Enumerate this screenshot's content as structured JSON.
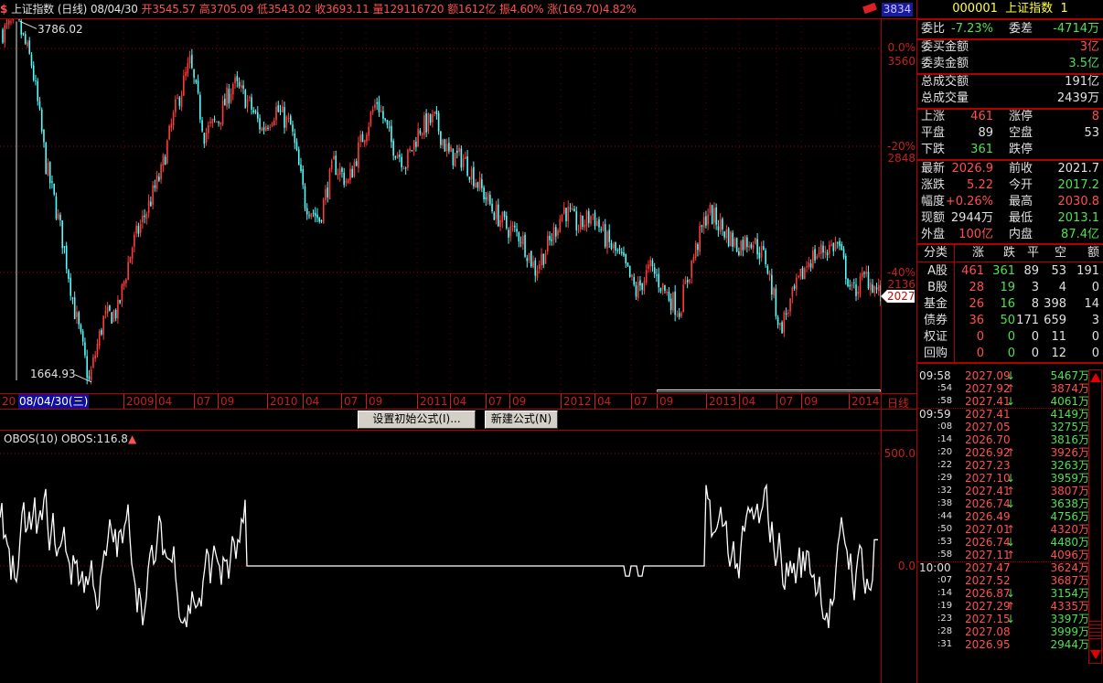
{
  "title": {
    "icon": "stock-icon",
    "name": "上证指数",
    "period": "(日线)",
    "date": "08/04/30",
    "open": "开3545.57",
    "high": "高3705.09",
    "low": "低3543.02",
    "close": "收3693.11",
    "volume": "量129116720",
    "amount": "额1612亿",
    "amplitude": "振4.60%",
    "change": "涨(169.70)4.82%"
  },
  "top_badge": "3834",
  "price_axis": {
    "pct0": "0.0%",
    "p0": "3560",
    "pct20": "-20%",
    "p20": "2848",
    "pct40": "-40%",
    "p40": "2136",
    "current": "2027"
  },
  "annotations": {
    "high": "3786.02",
    "low": "1664.93"
  },
  "xaxis": {
    "prefix": "20",
    "cursor": "08/04/30(三)",
    "labels": [
      "2009",
      "04",
      "07",
      "09",
      "2010",
      "04",
      "07",
      "09",
      "2011",
      "04",
      "07",
      "09",
      "2012",
      "04",
      "07",
      "09",
      "2013",
      "04",
      "07",
      "09",
      "2014"
    ],
    "period": "日线"
  },
  "buttons": {
    "init_formula": "设置初始公式(I)...",
    "new_formula": "新建公式(N)"
  },
  "obos": {
    "label": "OBOS(10)",
    "value": "OBOS:116.8",
    "axis_top": "500.0",
    "axis_zero": "0.0"
  },
  "chart_data": {
    "type": "candlestick",
    "scale": "log",
    "monthly_closes": [
      3700,
      3786,
      3440,
      2732,
      2361,
      1958,
      1665,
      1920,
      1960,
      2270,
      2460,
      2680,
      3100,
      3440,
      2930,
      3030,
      3290,
      3160,
      2960,
      3100,
      2980,
      2510,
      2410,
      2740,
      2620,
      2909,
      3161,
      2870,
      2740,
      2970,
      3030,
      2792,
      2770,
      2620,
      2470,
      2370,
      2320,
      2150,
      2290,
      2470,
      2370,
      2440,
      2290,
      2200,
      2041,
      2160,
      2050,
      1960,
      2218,
      2460,
      2360,
      2270,
      2310,
      2200,
      1877,
      2040,
      2200,
      2250,
      2280,
      2040,
      2120,
      2027
    ],
    "high": 3786.02,
    "low": 1664.93,
    "up_color": "#ff3c3c",
    "down_color": "#54fcfc",
    "obos_ylim": [
      -350,
      550
    ],
    "obos_last": 116.8
  },
  "panel": {
    "header": {
      "code": "000001",
      "name": "上证指数",
      "num": "1"
    },
    "weibi": {
      "l1": "委比",
      "v1": "-7.23%",
      "l2": "委差",
      "v2": "-4714万"
    },
    "buy_amt": {
      "l": "委买金额",
      "v": "3亿"
    },
    "sell_amt": {
      "l": "委卖金额",
      "v": "3.5亿"
    },
    "total_amt": {
      "l": "总成交额",
      "v": "191亿"
    },
    "total_vol": {
      "l": "总成交量",
      "v": "2439万"
    },
    "rise": {
      "l1": "上涨",
      "v1": "461",
      "l2": "涨停",
      "v2": "8"
    },
    "flat": {
      "l1": "平盘",
      "v1": "89",
      "l2": "空盘",
      "v2": "53"
    },
    "fall": {
      "l1": "下跌",
      "v1": "361",
      "l2": "跌停",
      "v2": ""
    },
    "latest": {
      "l1": "最新",
      "v1": "2026.9",
      "l2": "前收",
      "v2": "2021.7"
    },
    "chg": {
      "l1": "涨跌",
      "v1": "5.22",
      "l2": "今开",
      "v2": "2017.2"
    },
    "range": {
      "l1": "幅度",
      "v1": "+0.26%",
      "l2": "最高",
      "v2": "2030.8"
    },
    "cur": {
      "l1": "现额",
      "v1": "2944万",
      "l2": "最低",
      "v2": "2013.1"
    },
    "outer": {
      "l1": "外盘",
      "v1": "100亿",
      "l2": "内盘",
      "v2": "87.4亿"
    },
    "cat_head": [
      "分类",
      "涨",
      "跌",
      "平",
      "空",
      "额"
    ],
    "cats": [
      [
        "A股",
        "461",
        "361",
        "89",
        "53",
        "191"
      ],
      [
        "B股",
        "28",
        "19",
        "3",
        "4",
        "0"
      ],
      [
        "基金",
        "26",
        "16",
        "8",
        "398",
        "14"
      ],
      [
        "债券",
        "36",
        "50",
        "171",
        "659",
        "3"
      ],
      [
        "权证",
        "0",
        "0",
        "0",
        "11",
        "0"
      ],
      [
        "回购",
        "0",
        "0",
        "0",
        "12",
        "0"
      ]
    ],
    "ticks": [
      [
        "09:58",
        "2027.09",
        "down",
        "5467万",
        "g"
      ],
      [
        ":54",
        "2027.92",
        "up",
        "3874万",
        "r"
      ],
      [
        ":58",
        "2027.41",
        "down",
        "4061万",
        "g"
      ],
      [
        "09:59",
        "2027.41",
        "",
        "4149万",
        "g"
      ],
      [
        ":08",
        "2027.05",
        "",
        "3275万",
        "g"
      ],
      [
        ":14",
        "2026.70",
        "",
        "3816万",
        "g"
      ],
      [
        ":20",
        "2026.92",
        "up",
        "3926万",
        "r"
      ],
      [
        ":22",
        "2027.23",
        "",
        "3263万",
        "g"
      ],
      [
        ":29",
        "2027.10",
        "down",
        "3959万",
        "g"
      ],
      [
        ":32",
        "2027.41",
        "up",
        "3807万",
        "r"
      ],
      [
        ":38",
        "2026.74",
        "down",
        "3638万",
        "g"
      ],
      [
        ":44",
        "2026.49",
        "",
        "4756万",
        "g"
      ],
      [
        ":50",
        "2027.01",
        "up",
        "4320万",
        "r"
      ],
      [
        ":53",
        "2026.74",
        "down",
        "4480万",
        "g"
      ],
      [
        ":58",
        "2027.11",
        "up",
        "4096万",
        "r"
      ],
      [
        "10:00",
        "2027.47",
        "",
        "3624万",
        "r"
      ],
      [
        ":07",
        "2027.52",
        "",
        "3687万",
        "r"
      ],
      [
        ":14",
        "2026.87",
        "down",
        "3154万",
        "g"
      ],
      [
        ":19",
        "2027.29",
        "up",
        "4335万",
        "r"
      ],
      [
        ":23",
        "2027.15",
        "down",
        "3397万",
        "g"
      ],
      [
        ":28",
        "2027.08",
        "",
        "3999万",
        "g"
      ],
      [
        ":31",
        "2026.95",
        "",
        "2944万",
        "g"
      ]
    ]
  }
}
